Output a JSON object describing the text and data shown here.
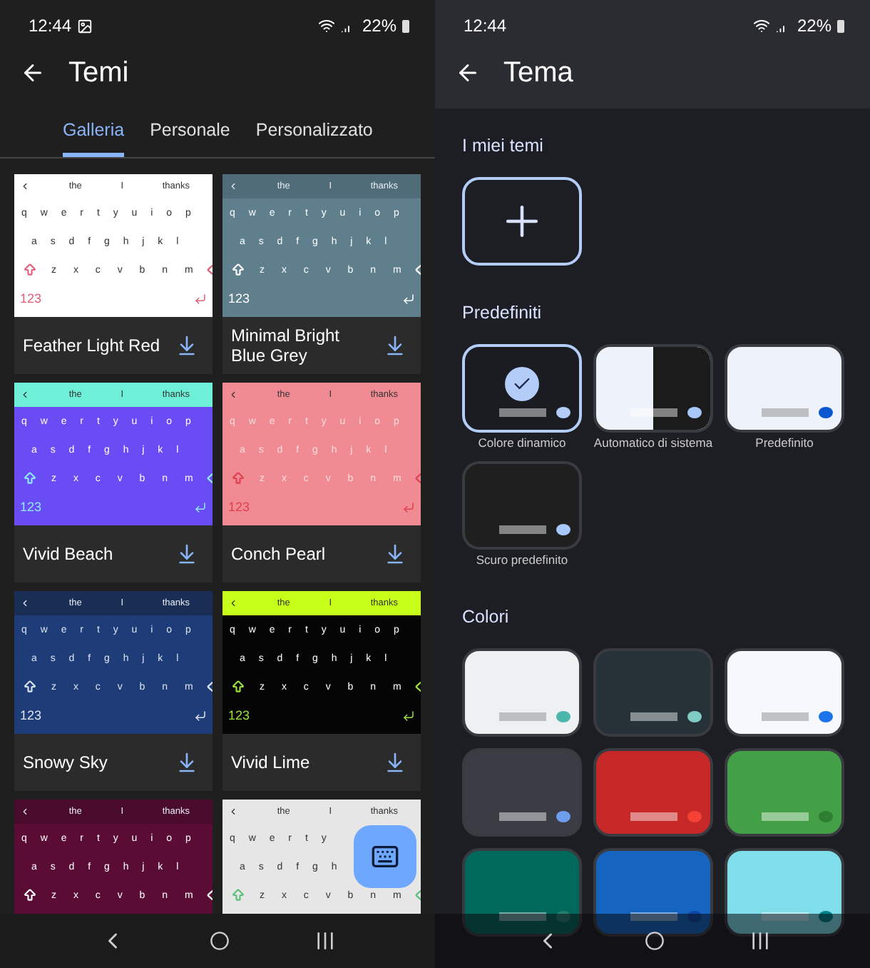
{
  "left_screen": {
    "status_bar": {
      "time": "12:44",
      "battery": "22%"
    },
    "title": "Temi",
    "tabs": [
      {
        "label": "Galleria",
        "selected": true
      },
      {
        "label": "Personale",
        "selected": false
      },
      {
        "label": "Personalizzato",
        "selected": false
      }
    ],
    "themes": [
      {
        "name": "Feather Light Red",
        "color": "#ffffff",
        "suggestion_bar": {
          "color": "#ffffff",
          "words": [
            "the",
            "I",
            "thanks"
          ]
        },
        "keys": {
          "color": "#333333",
          "rows": [
            "q w e r t y u i o p",
            "a s d f g h j k l",
            "z x c v b n m"
          ]
        },
        "special_keys": {
          "color": "#e0607a",
          "numbers_label": "123"
        }
      },
      {
        "name": "Minimal Bright Blue Grey",
        "color": "#5f7f8c",
        "suggestion_bar": {
          "color": "#4f6c78",
          "words": [
            "the",
            "I",
            "thanks"
          ]
        },
        "keys": {
          "color": "#ffffff",
          "rows": [
            "q w e r t y u i o p",
            "a s d f g h j k l",
            "z x c v b n m"
          ]
        },
        "special_keys": {
          "color": "#ffffff",
          "numbers_label": "123"
        }
      },
      {
        "name": "Vivid Beach",
        "color": "#6a4cf5",
        "suggestion_bar": {
          "color": "#6ef0d8",
          "words": [
            "the",
            "I",
            "thanks"
          ]
        },
        "keys": {
          "color": "#ffffff",
          "rows": [
            "q w e r t y u i o p",
            "a s d f g h j k l",
            "z x c v b n m"
          ]
        },
        "special_keys": {
          "color": "#8fe8ff",
          "numbers_label": "123"
        }
      },
      {
        "name": "Conch Pearl",
        "color": "#f08a93",
        "suggestion_bar": {
          "color": "#f08a93",
          "words": [
            "the",
            "I",
            "thanks"
          ]
        },
        "keys": {
          "color": "#fcdde0",
          "rows": [
            "q w e r t y u i o p",
            "a s d f g h j k l",
            "z x c v b n m"
          ]
        },
        "special_keys": {
          "color": "#e0404f",
          "numbers_label": "123"
        }
      },
      {
        "name": "Snowy Sky",
        "color": "#1d3c78",
        "suggestion_bar": {
          "color": "#1a2d55",
          "words": [
            "the",
            "I",
            "thanks"
          ]
        },
        "keys": {
          "color": "#dde4f0",
          "rows": [
            "q w e r t y u i o p",
            "a s d f g h j k l",
            "z x c v b n m"
          ]
        },
        "special_keys": {
          "color": "#dde4f0",
          "numbers_label": "123"
        }
      },
      {
        "name": "Vivid Lime",
        "color": "#050505",
        "suggestion_bar": {
          "color": "#c8ff1a",
          "words": [
            "the",
            "I",
            "thanks"
          ]
        },
        "keys": {
          "color": "#ffffff",
          "rows": [
            "q w e r t y u i o p",
            "a s d f g h j k l",
            "z x c v b n m"
          ]
        },
        "special_keys": {
          "color": "#9be13c",
          "numbers_label": "123"
        }
      },
      {
        "color": "#5a0c35",
        "suggestion_bar": {
          "color": "#4a0a2b",
          "words": [
            "the",
            "I",
            "thanks"
          ]
        },
        "keys": {
          "color": "#ffffff",
          "rows": [
            "q w e r t y u i o p",
            "a s d f g h j k l",
            "z x c v b n m"
          ]
        },
        "special_keys": {
          "color": "#ffffff"
        }
      },
      {
        "color": "#e6e6e6",
        "suggestion_bar": {
          "color": "#e6e6e6",
          "words": [
            "the",
            "I",
            "thanks"
          ]
        },
        "keys": {
          "color": "#333333",
          "rows": [
            "q w e r t y",
            "a s d f g h",
            "z x c v b n m"
          ]
        },
        "special_keys": {
          "color": "#5bbf7a"
        }
      }
    ]
  },
  "right_screen": {
    "status_bar": {
      "time": "12:44",
      "battery": "22%"
    },
    "title": "Tema",
    "my_themes_heading": "I miei temi",
    "presets_heading": "Predefiniti",
    "presets": [
      {
        "label": "Colore dinamico",
        "kind": "dynamic",
        "color": "#1b1c22",
        "dot": {
          "color": "#b3cdf8"
        },
        "selected": true
      },
      {
        "label": "Automatico di sistema",
        "kind": "split",
        "color": "#eef2fa",
        "dot": {
          "color": "#a8c7fa"
        },
        "selected": false
      },
      {
        "label": "Predefinito",
        "kind": "plain",
        "color": "#eef2fa",
        "dot": {
          "color": "#0b57d0"
        },
        "selected": false
      },
      {
        "label": "Scuro predefinito",
        "kind": "plain",
        "color": "#1f1f1f",
        "dot": {
          "color": "#a8c7fa"
        },
        "selected": false
      }
    ],
    "colors_heading": "Colori",
    "colors": [
      {
        "color": "#eef0f2",
        "dot": {
          "color": "#4db6ac"
        }
      },
      {
        "color": "#263238",
        "dot": {
          "color": "#80cbc4"
        }
      },
      {
        "color": "#f5f8fc",
        "dot": {
          "color": "#1a73e8"
        }
      },
      {
        "color": "#3a3d44",
        "dot": {
          "color": "#6d9eeb"
        }
      },
      {
        "color": "#c62828",
        "dot": {
          "color": "#f44336"
        }
      },
      {
        "color": "#43a047",
        "dot": {
          "color": "#2e7d32"
        }
      },
      {
        "color": "#00695c",
        "dot": {
          "color": "#26806f"
        }
      },
      {
        "color": "#1565c0",
        "dot": {
          "color": "#0d47a1"
        }
      },
      {
        "color": "#80deea",
        "dot": {
          "color": "#00838f"
        }
      }
    ]
  }
}
